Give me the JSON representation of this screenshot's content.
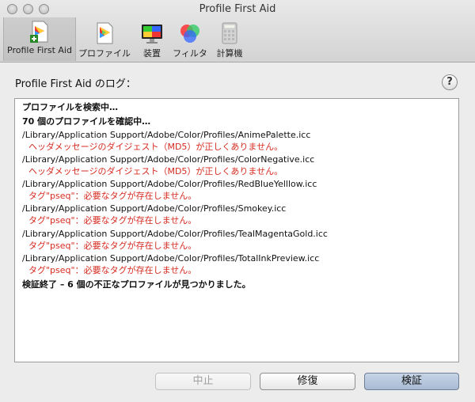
{
  "window": {
    "title": "Profile First Aid"
  },
  "toolbar": {
    "items": [
      {
        "label": "Profile First Aid",
        "icon": "profile-first-aid-icon"
      },
      {
        "label": "プロファイル",
        "icon": "profile-document-icon"
      },
      {
        "label": "装置",
        "icon": "display-device-icon"
      },
      {
        "label": "フィルタ",
        "icon": "color-filter-icon"
      },
      {
        "label": "計算機",
        "icon": "calculator-icon"
      }
    ]
  },
  "log": {
    "label": "Profile First Aid のログ：",
    "lines": [
      "プロファイルを検索中…",
      "70 個のプロファイルを確認中…",
      "/Library/Application Support/Adobe/Color/Profiles/AnimePalette.icc",
      "ヘッダメッセージのダイジェスト（MD5）が正しくありません。",
      "/Library/Application Support/Adobe/Color/Profiles/ColorNegative.icc",
      "ヘッダメッセージのダイジェスト（MD5）が正しくありません。",
      "/Library/Application Support/Adobe/Color/Profiles/RedBlueYelllow.icc",
      "タグ\"pseq\"：必要なタグが存在しません。",
      "/Library/Application Support/Adobe/Color/Profiles/Smokey.icc",
      "タグ\"pseq\"：必要なタグが存在しません。",
      "/Library/Application Support/Adobe/Color/Profiles/TealMagentaGold.icc",
      "タグ\"pseq\"：必要なタグが存在しません。",
      "/Library/Application Support/Adobe/Color/Profiles/TotalInkPreview.icc",
      "タグ\"pseq\"：必要なタグが存在しません。",
      "検証終了 – 6 個の不正なプロファイルが見つかりました。"
    ]
  },
  "help": {
    "label": "?"
  },
  "buttons": {
    "stop": "中止",
    "repair": "修復",
    "verify": "検証"
  },
  "colors": {
    "error": "#d62b20",
    "default_button": "#a9bbd4"
  }
}
